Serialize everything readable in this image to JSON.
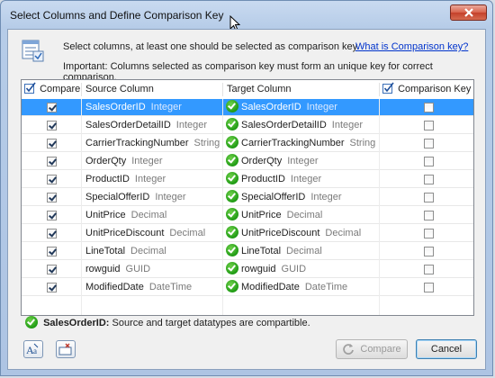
{
  "window": {
    "title": "Select Columns and Define Comparison Key"
  },
  "info": {
    "line1": "Select columns, at least one should be selected as comparison key.",
    "link": "What is Comparison key?",
    "line2": "Important: Columns selected as comparison key must form an unique key for correct comparison."
  },
  "grid": {
    "headers": {
      "compare": "Compare",
      "source": "Source Column",
      "target": "Target Column",
      "key": "Comparison Key"
    },
    "selected_row": 0,
    "rows": [
      {
        "compare": true,
        "source": "SalesOrderID",
        "source_type": "Integer",
        "target": "SalesOrderID",
        "target_type": "Integer",
        "key": false
      },
      {
        "compare": true,
        "source": "SalesOrderDetailID",
        "source_type": "Integer",
        "target": "SalesOrderDetailID",
        "target_type": "Integer",
        "key": false
      },
      {
        "compare": true,
        "source": "CarrierTrackingNumber",
        "source_type": "String",
        "target": "CarrierTrackingNumber",
        "target_type": "String",
        "key": false
      },
      {
        "compare": true,
        "source": "OrderQty",
        "source_type": "Integer",
        "target": "OrderQty",
        "target_type": "Integer",
        "key": false
      },
      {
        "compare": true,
        "source": "ProductID",
        "source_type": "Integer",
        "target": "ProductID",
        "target_type": "Integer",
        "key": false
      },
      {
        "compare": true,
        "source": "SpecialOfferID",
        "source_type": "Integer",
        "target": "SpecialOfferID",
        "target_type": "Integer",
        "key": false
      },
      {
        "compare": true,
        "source": "UnitPrice",
        "source_type": "Decimal",
        "target": "UnitPrice",
        "target_type": "Decimal",
        "key": false
      },
      {
        "compare": true,
        "source": "UnitPriceDiscount",
        "source_type": "Decimal",
        "target": "UnitPriceDiscount",
        "target_type": "Decimal",
        "key": false
      },
      {
        "compare": true,
        "source": "LineTotal",
        "source_type": "Decimal",
        "target": "LineTotal",
        "target_type": "Decimal",
        "key": false
      },
      {
        "compare": true,
        "source": "rowguid",
        "source_type": "GUID",
        "target": "rowguid",
        "target_type": "GUID",
        "key": false
      },
      {
        "compare": true,
        "source": "ModifiedDate",
        "source_type": "DateTime",
        "target": "ModifiedDate",
        "target_type": "DateTime",
        "key": false
      }
    ]
  },
  "status": {
    "column": "SalesOrderID:",
    "message": " Source and target datatypes are compartible."
  },
  "buttons": {
    "compare": "Compare",
    "cancel": "Cancel"
  },
  "icons": {
    "info": "table-settings-icon",
    "close": "close-icon",
    "font": "font-icon",
    "clear": "clear-icon",
    "compare": "refresh-icon",
    "status": "check-circle-icon"
  },
  "colors": {
    "selection": "#3399ff",
    "link": "#0033cc",
    "ok": "#1f9b14",
    "close": "#c4402a"
  }
}
